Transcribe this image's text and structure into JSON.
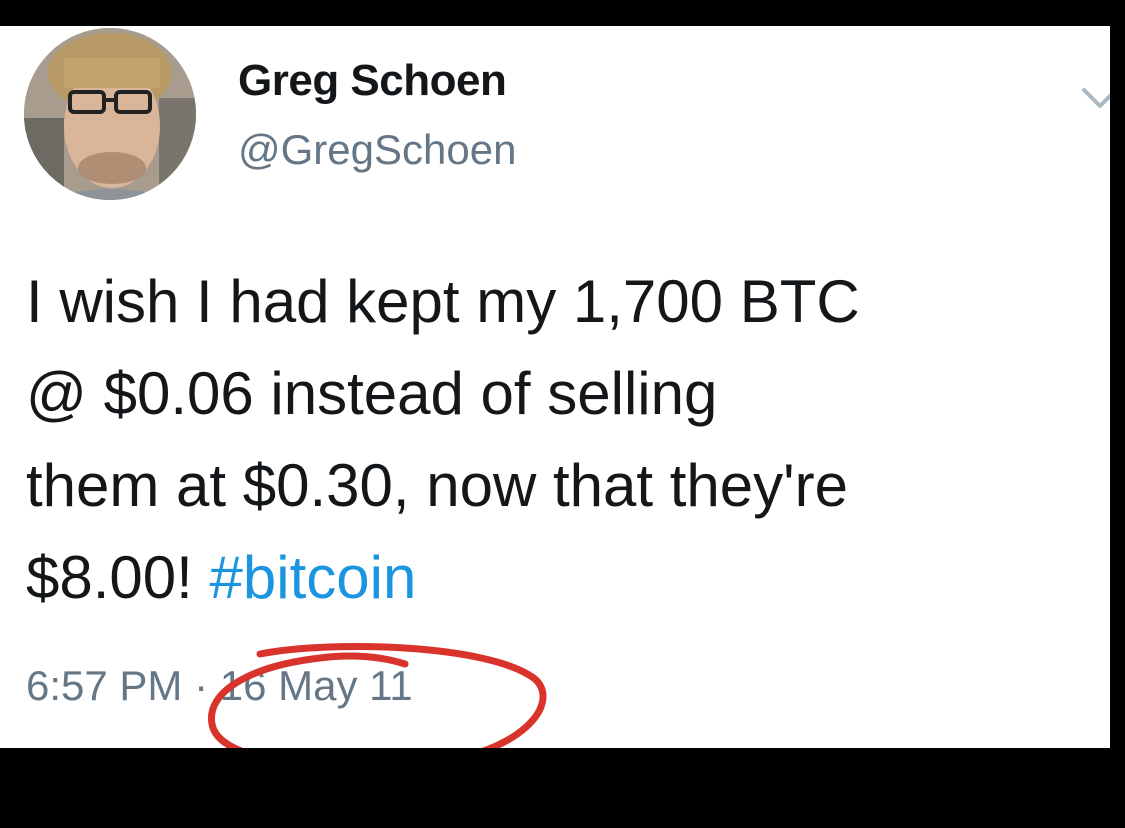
{
  "tweet": {
    "author": {
      "name": "Greg Schoen",
      "handle": "@GregSchoen",
      "avatar_icon": "profile-photo"
    },
    "menu_icon": "chevron-down-icon",
    "text_lines": [
      "I wish I had kept my 1,700 BTC",
      "@ $0.06 instead of selling",
      "them at $0.30, now that they're",
      "$8.00! "
    ],
    "hashtag": "#bitcoin",
    "timestamp": {
      "time": "6:57 PM",
      "separator": " · ",
      "date": "16 May 11"
    },
    "annotation_color": "#d9342b",
    "link_color": "#1b95e0"
  }
}
